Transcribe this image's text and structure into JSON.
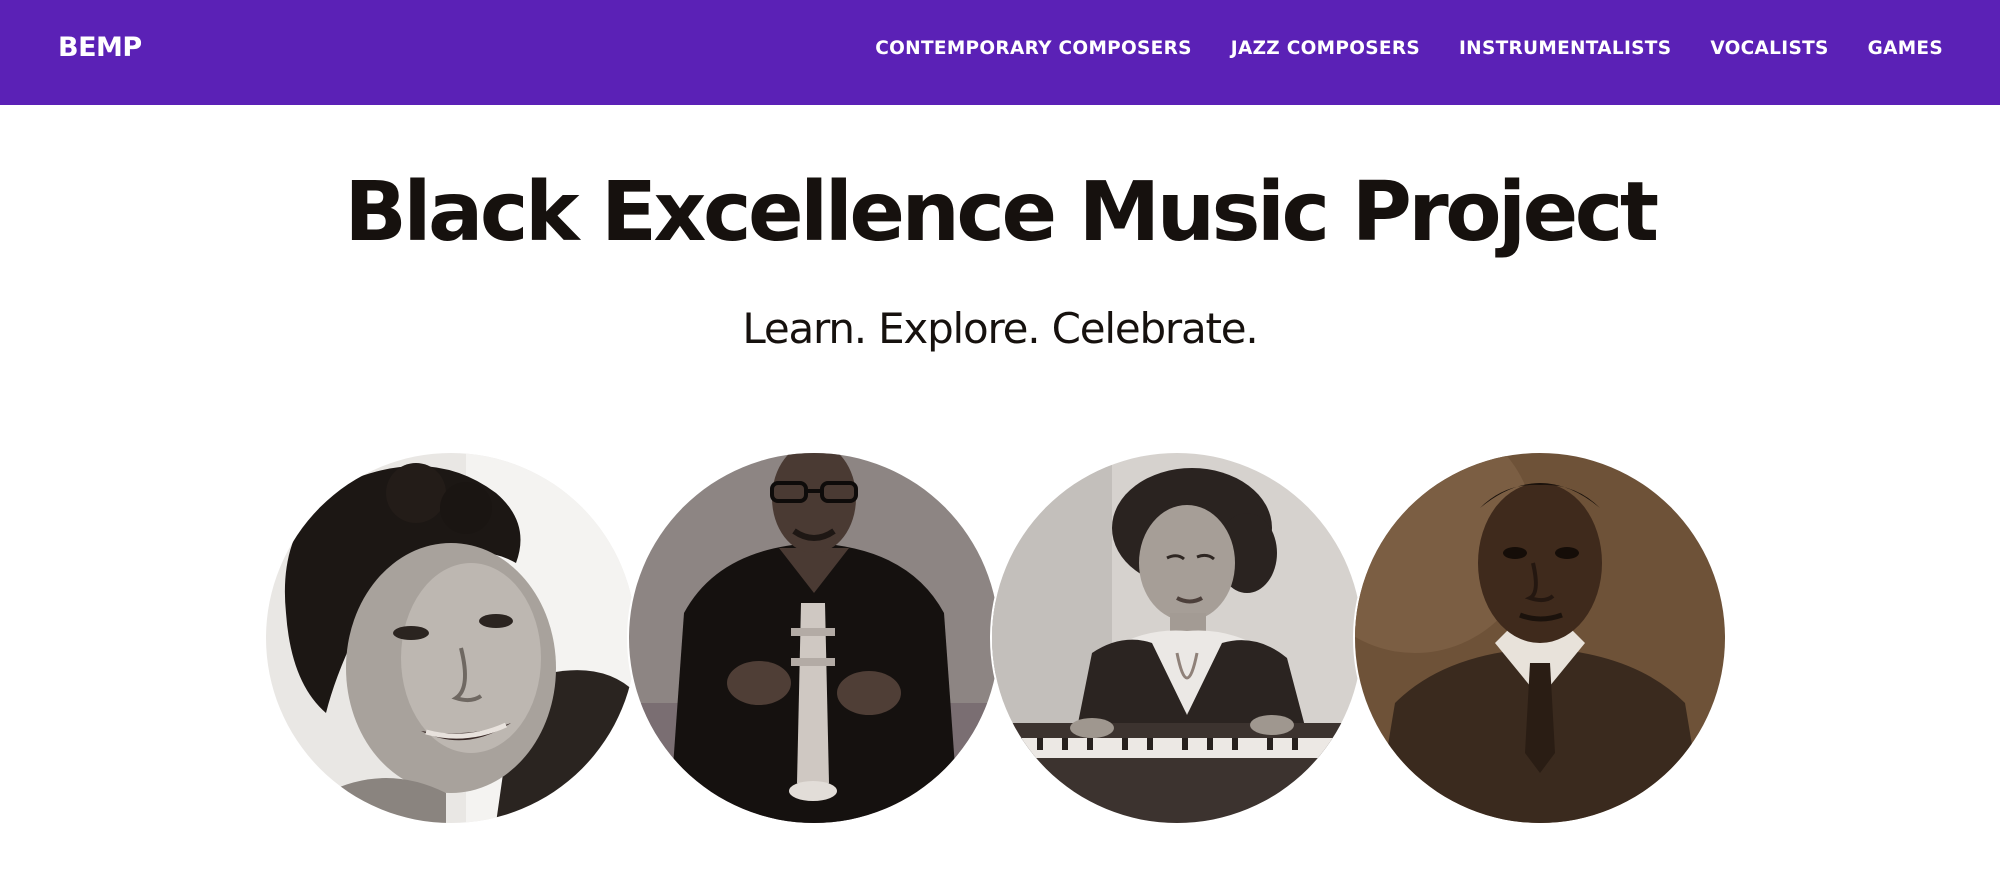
{
  "navbar": {
    "brand": "BEMP",
    "links": [
      {
        "label": "CONTEMPORARY COMPOSERS"
      },
      {
        "label": "JAZZ COMPOSERS"
      },
      {
        "label": "INSTRUMENTALISTS"
      },
      {
        "label": "VOCALISTS"
      },
      {
        "label": "GAMES"
      }
    ]
  },
  "hero": {
    "title": "Black Excellence Music Project",
    "subtitle": "Learn. Explore. Celebrate."
  },
  "portraits": [
    {
      "subject": "vocalist-portrait",
      "tone": "#b8b3ae"
    },
    {
      "subject": "trumpet-player-portrait",
      "tone": "#8f8785"
    },
    {
      "subject": "pianist-portrait",
      "tone": "#c9c5c1"
    },
    {
      "subject": "composer-portrait",
      "tone": "#6b5038"
    }
  ],
  "colors": {
    "nav_background": "#5b21b6",
    "nav_text": "#ffffff",
    "heading_text": "#16110e",
    "page_background": "#ffffff"
  }
}
